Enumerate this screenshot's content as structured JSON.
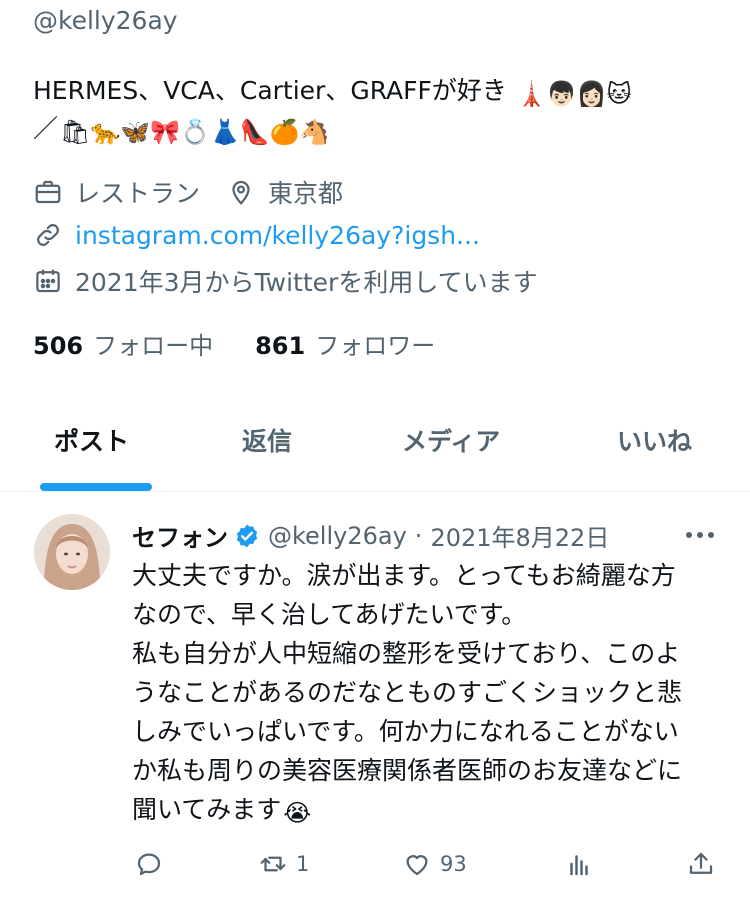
{
  "profile": {
    "handle": "@kelly26ay",
    "bio_line1": "HERMES、VCA、Cartier、GRAFFが好き",
    "bio_line1_emojis": "🗼👦🏻👩🏻🐱",
    "bio_line2_prefix": "／",
    "bio_line2_emojis": "🛍🐆🦋🎀💍👗👠🍊🐴",
    "occupation": "レストラン",
    "location": "東京都",
    "website": "instagram.com/kelly26ay?igsh...",
    "joined": "2021年3月からTwitterを利用しています",
    "following_count": "506",
    "following_label": "フォロー中",
    "followers_count": "861",
    "followers_label": "フォロワー"
  },
  "tabs": [
    {
      "label": "ポスト",
      "active": true
    },
    {
      "label": "返信",
      "active": false
    },
    {
      "label": "メディア",
      "active": false
    },
    {
      "label": "いいね",
      "active": false
    }
  ],
  "tweet": {
    "display_name": "セフォン",
    "handle": "@kelly26ay",
    "separator": "·",
    "date": "2021年8月22日",
    "text_line1": "大丈夫ですか。涙が出ます。とってもお綺麗な方",
    "text_line2": "なので、早く治してあげたいです。",
    "text_line3": "私も自分が人中短縮の整形を受けており、このよ",
    "text_line4": "うなことがあるのだなとものすごくショックと悲",
    "text_line5": "しみでいっぱいです。何か力になれることがない",
    "text_line6": "か私も周りの美容医療関係者医師のお友達などに",
    "text_line7": "聞いてみます",
    "text_emoji": "😭",
    "replies": "",
    "retweets": "1",
    "likes": "93"
  },
  "colors": {
    "accent": "#1d9bf0",
    "secondary_text": "#536471",
    "primary_text": "#0f1419"
  }
}
